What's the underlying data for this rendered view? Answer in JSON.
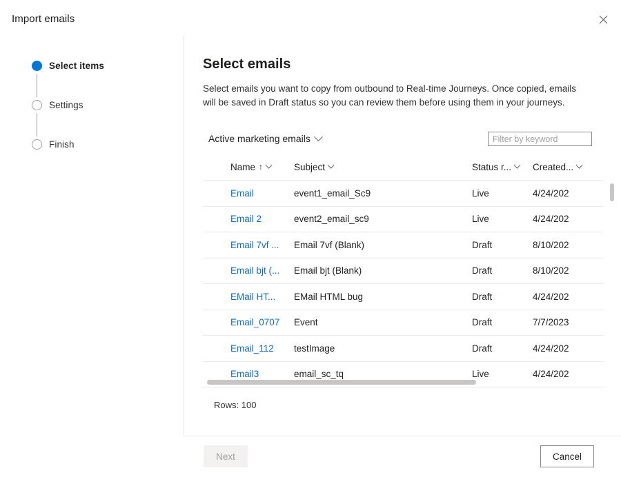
{
  "dialog": {
    "title": "Import emails",
    "close_icon": "close-icon"
  },
  "wizard": {
    "steps": [
      {
        "label": "Select items",
        "state": "active"
      },
      {
        "label": "Settings",
        "state": "pending"
      },
      {
        "label": "Finish",
        "state": "pending"
      }
    ]
  },
  "content": {
    "heading": "Select emails",
    "description": "Select emails you want to copy from outbound to Real-time Journeys. Once copied, emails will be saved in Draft status so you can review them before using them in your journeys."
  },
  "toolbar": {
    "view_selector_label": "Active marketing emails",
    "view_selector_icon": "chevron-down-icon",
    "filter_placeholder": "Filter by keyword",
    "filter_value": ""
  },
  "grid": {
    "columns": [
      {
        "label": "Name",
        "sort": "↑",
        "menu_icon": "chevron-down-icon"
      },
      {
        "label": "Subject",
        "sort": "",
        "menu_icon": "chevron-down-icon"
      },
      {
        "label": "Status r...",
        "sort": "",
        "menu_icon": "chevron-down-icon"
      },
      {
        "label": "Created...",
        "sort": "",
        "menu_icon": "chevron-down-icon"
      }
    ],
    "rows": [
      {
        "name": "Email",
        "subject": "event1_email_Sc9",
        "status": "Live",
        "created": "4/24/202"
      },
      {
        "name": "Email 2",
        "subject": "event2_email_sc9",
        "status": "Live",
        "created": "4/24/202"
      },
      {
        "name": "Email 7vf ...",
        "subject": "Email 7vf (Blank)",
        "status": "Draft",
        "created": "8/10/202"
      },
      {
        "name": "Email bjt (...",
        "subject": "Email bjt (Blank)",
        "status": "Draft",
        "created": "8/10/202"
      },
      {
        "name": "EMail HT...",
        "subject": "EMail HTML bug",
        "status": "Draft",
        "created": "4/24/202"
      },
      {
        "name": "Email_0707",
        "subject": "Event",
        "status": "Draft",
        "created": "7/7/2023"
      },
      {
        "name": "Email_112",
        "subject": "testImage",
        "status": "Draft",
        "created": "4/24/202"
      },
      {
        "name": "Email3",
        "subject": "email_sc_tq",
        "status": "Live",
        "created": "4/24/202"
      }
    ],
    "rows_count_label": "Rows: 100"
  },
  "footer": {
    "next_label": "Next",
    "cancel_label": "Cancel"
  },
  "colors": {
    "accent": "#0078d4",
    "link": "#0f6cbd",
    "border": "#edebe9",
    "scrollbar": "#c8c6c4"
  }
}
